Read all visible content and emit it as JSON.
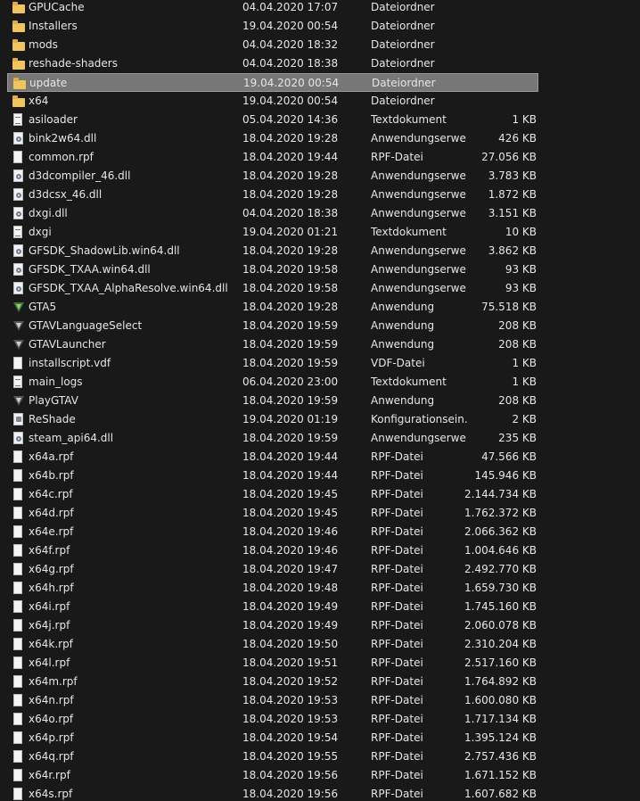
{
  "files": [
    {
      "name": "GPUCache",
      "date": "04.04.2020 17:07",
      "type": "Dateiordner",
      "size": "",
      "icon": "folder-icon"
    },
    {
      "name": "Installers",
      "date": "19.04.2020 00:54",
      "type": "Dateiordner",
      "size": "",
      "icon": "folder-icon"
    },
    {
      "name": "mods",
      "date": "04.04.2020 18:32",
      "type": "Dateiordner",
      "size": "",
      "icon": "folder-icon"
    },
    {
      "name": "reshade-shaders",
      "date": "04.04.2020 18:38",
      "type": "Dateiordner",
      "size": "",
      "icon": "folder-icon"
    },
    {
      "name": "update",
      "date": "19.04.2020 00:54",
      "type": "Dateiordner",
      "size": "",
      "icon": "folder-icon",
      "selected": true
    },
    {
      "name": "x64",
      "date": "19.04.2020 00:54",
      "type": "Dateiordner",
      "size": "",
      "icon": "folder-icon"
    },
    {
      "name": "asiloader",
      "date": "05.04.2020 14:36",
      "type": "Textdokument",
      "size": "1 KB",
      "icon": "text-document-icon"
    },
    {
      "name": "bink2w64.dll",
      "date": "18.04.2020 19:28",
      "type": "Anwendungserwe...",
      "size": "426 KB",
      "icon": "dll-file-icon"
    },
    {
      "name": "common.rpf",
      "date": "18.04.2020 19:44",
      "type": "RPF-Datei",
      "size": "27.056 KB",
      "icon": "file-icon"
    },
    {
      "name": "d3dcompiler_46.dll",
      "date": "18.04.2020 19:28",
      "type": "Anwendungserwe...",
      "size": "3.783 KB",
      "icon": "dll-file-icon"
    },
    {
      "name": "d3dcsx_46.dll",
      "date": "18.04.2020 19:28",
      "type": "Anwendungserwe...",
      "size": "1.872 KB",
      "icon": "dll-file-icon"
    },
    {
      "name": "dxgi.dll",
      "date": "04.04.2020 18:38",
      "type": "Anwendungserwe...",
      "size": "3.151 KB",
      "icon": "dll-file-icon"
    },
    {
      "name": "dxgi",
      "date": "19.04.2020 01:21",
      "type": "Textdokument",
      "size": "10 KB",
      "icon": "text-document-icon"
    },
    {
      "name": "GFSDK_ShadowLib.win64.dll",
      "date": "18.04.2020 19:28",
      "type": "Anwendungserwe...",
      "size": "3.862 KB",
      "icon": "dll-file-icon"
    },
    {
      "name": "GFSDK_TXAA.win64.dll",
      "date": "18.04.2020 19:58",
      "type": "Anwendungserwe...",
      "size": "93 KB",
      "icon": "dll-file-icon"
    },
    {
      "name": "GFSDK_TXAA_AlphaResolve.win64.dll",
      "date": "18.04.2020 19:58",
      "type": "Anwendungserwe...",
      "size": "93 KB",
      "icon": "dll-file-icon"
    },
    {
      "name": "GTA5",
      "date": "18.04.2020 19:28",
      "type": "Anwendung",
      "size": "75.518 KB",
      "icon": "gta-v-icon"
    },
    {
      "name": "GTAVLanguageSelect",
      "date": "18.04.2020 19:59",
      "type": "Anwendung",
      "size": "208 KB",
      "icon": "gta-launcher-icon"
    },
    {
      "name": "GTAVLauncher",
      "date": "18.04.2020 19:59",
      "type": "Anwendung",
      "size": "208 KB",
      "icon": "gta-launcher-icon"
    },
    {
      "name": "installscript.vdf",
      "date": "18.04.2020 19:59",
      "type": "VDF-Datei",
      "size": "1 KB",
      "icon": "file-icon"
    },
    {
      "name": "main_logs",
      "date": "06.04.2020 23:00",
      "type": "Textdokument",
      "size": "1 KB",
      "icon": "text-document-icon"
    },
    {
      "name": "PlayGTAV",
      "date": "18.04.2020 19:59",
      "type": "Anwendung",
      "size": "208 KB",
      "icon": "gta-launcher-icon"
    },
    {
      "name": "ReShade",
      "date": "19.04.2020 01:19",
      "type": "Konfigurationsein...",
      "size": "2 KB",
      "icon": "settings-file-icon"
    },
    {
      "name": "steam_api64.dll",
      "date": "18.04.2020 19:59",
      "type": "Anwendungserwe...",
      "size": "235 KB",
      "icon": "dll-file-icon"
    },
    {
      "name": "x64a.rpf",
      "date": "18.04.2020 19:44",
      "type": "RPF-Datei",
      "size": "47.566 KB",
      "icon": "file-icon"
    },
    {
      "name": "x64b.rpf",
      "date": "18.04.2020 19:44",
      "type": "RPF-Datei",
      "size": "145.946 KB",
      "icon": "file-icon"
    },
    {
      "name": "x64c.rpf",
      "date": "18.04.2020 19:45",
      "type": "RPF-Datei",
      "size": "2.144.734 KB",
      "icon": "file-icon"
    },
    {
      "name": "x64d.rpf",
      "date": "18.04.2020 19:45",
      "type": "RPF-Datei",
      "size": "1.762.372 KB",
      "icon": "file-icon"
    },
    {
      "name": "x64e.rpf",
      "date": "18.04.2020 19:46",
      "type": "RPF-Datei",
      "size": "2.066.362 KB",
      "icon": "file-icon"
    },
    {
      "name": "x64f.rpf",
      "date": "18.04.2020 19:46",
      "type": "RPF-Datei",
      "size": "1.004.646 KB",
      "icon": "file-icon"
    },
    {
      "name": "x64g.rpf",
      "date": "18.04.2020 19:47",
      "type": "RPF-Datei",
      "size": "2.492.770 KB",
      "icon": "file-icon"
    },
    {
      "name": "x64h.rpf",
      "date": "18.04.2020 19:48",
      "type": "RPF-Datei",
      "size": "1.659.730 KB",
      "icon": "file-icon"
    },
    {
      "name": "x64i.rpf",
      "date": "18.04.2020 19:49",
      "type": "RPF-Datei",
      "size": "1.745.160 KB",
      "icon": "file-icon"
    },
    {
      "name": "x64j.rpf",
      "date": "18.04.2020 19:49",
      "type": "RPF-Datei",
      "size": "2.060.078 KB",
      "icon": "file-icon"
    },
    {
      "name": "x64k.rpf",
      "date": "18.04.2020 19:50",
      "type": "RPF-Datei",
      "size": "2.310.204 KB",
      "icon": "file-icon"
    },
    {
      "name": "x64l.rpf",
      "date": "18.04.2020 19:51",
      "type": "RPF-Datei",
      "size": "2.517.160 KB",
      "icon": "file-icon"
    },
    {
      "name": "x64m.rpf",
      "date": "18.04.2020 19:52",
      "type": "RPF-Datei",
      "size": "1.764.892 KB",
      "icon": "file-icon"
    },
    {
      "name": "x64n.rpf",
      "date": "18.04.2020 19:53",
      "type": "RPF-Datei",
      "size": "1.600.080 KB",
      "icon": "file-icon"
    },
    {
      "name": "x64o.rpf",
      "date": "18.04.2020 19:53",
      "type": "RPF-Datei",
      "size": "1.717.134 KB",
      "icon": "file-icon"
    },
    {
      "name": "x64p.rpf",
      "date": "18.04.2020 19:54",
      "type": "RPF-Datei",
      "size": "1.395.124 KB",
      "icon": "file-icon"
    },
    {
      "name": "x64q.rpf",
      "date": "18.04.2020 19:55",
      "type": "RPF-Datei",
      "size": "2.757.436 KB",
      "icon": "file-icon"
    },
    {
      "name": "x64r.rpf",
      "date": "18.04.2020 19:56",
      "type": "RPF-Datei",
      "size": "1.671.152 KB",
      "icon": "file-icon"
    },
    {
      "name": "x64s.rpf",
      "date": "18.04.2020 19:56",
      "type": "RPF-Datei",
      "size": "1.607.682 KB",
      "icon": "file-icon"
    }
  ],
  "colors": {
    "background": "#191919",
    "text": "#e6e6e6",
    "selection": "#777777",
    "folder": "#f2c55c"
  }
}
